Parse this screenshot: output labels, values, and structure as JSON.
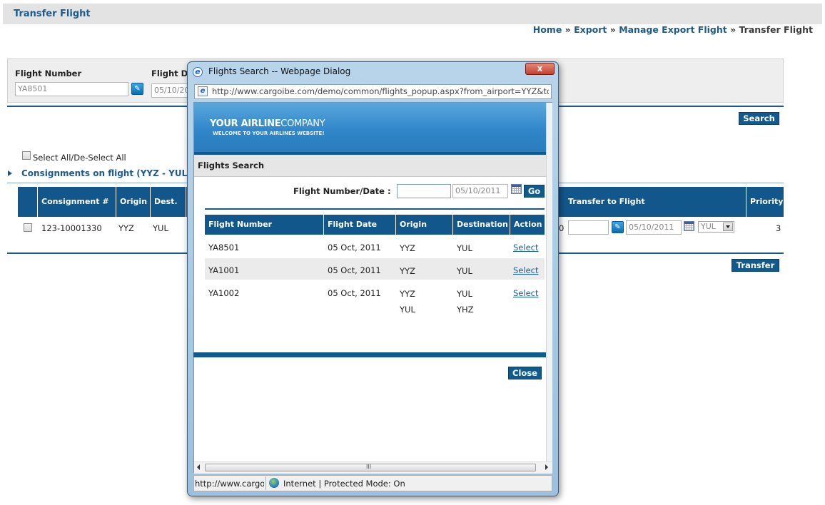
{
  "page": {
    "title": "Transfer Flight",
    "breadcrumb": {
      "home": "Home",
      "export": "Export",
      "manage": "Manage Export Flight",
      "current": "Transfer Flight",
      "sep": "»"
    }
  },
  "search": {
    "flight_number_label": "Flight Number",
    "flight_number_value": "YA8501",
    "flight_date_label": "Flight D",
    "flight_date_value": "05/10/20",
    "search_button": "Search"
  },
  "consignments": {
    "select_all_label": "Select All/De-Select All",
    "section_title": "Consignments on flight (YYZ - YUL)",
    "columns": [
      "Consignment #",
      "Origin",
      "Dest.",
      "Transfer to Flight",
      "Priority"
    ],
    "rows": [
      {
        "consignment": "123-10001330",
        "origin": "YYZ",
        "dest": "YUL",
        "hidden_partial": "0",
        "transfer_flight": "",
        "transfer_date": "05/10/2011",
        "transfer_dest": "YUL",
        "priority": "3"
      }
    ],
    "transfer_button": "Transfer"
  },
  "dialog": {
    "window_title": "Flights Search -- Webpage Dialog",
    "url": "http://www.cargoibe.com/demo/common/flights_popup.aspx?from_airport=YYZ&to_air",
    "banner": {
      "name_bold": "YOUR AIRLINE",
      "name_thin": "COMPANY",
      "tagline": "WELCOME TO YOUR AIRLINES WEBSITE!"
    },
    "header": "Flights Search",
    "search_label": "Flight Number/Date :",
    "flight_input": "",
    "date_input": "05/10/2011",
    "go_button": "Go",
    "columns": [
      "Flight Number",
      "Flight Date",
      "Origin",
      "Destination",
      "Action"
    ],
    "rows": [
      {
        "flight": "YA8501",
        "date": "05 Oct, 2011",
        "origin": "YYZ",
        "destination": "YUL",
        "origin2": "",
        "destination2": "",
        "action": "Select"
      },
      {
        "flight": "YA1001",
        "date": "05 Oct, 2011",
        "origin": "YYZ",
        "destination": "YUL",
        "origin2": "",
        "destination2": "",
        "action": "Select"
      },
      {
        "flight": "YA1002",
        "date": "05 Oct, 2011",
        "origin": "YYZ",
        "destination": "YUL",
        "origin2": "YUL",
        "destination2": "YHZ",
        "action": "Select"
      }
    ],
    "close_button": "Close",
    "status_url": "http://www.cargoi",
    "status_zone": "Internet | Protected Mode: On",
    "close_glyph": "x",
    "scroll_grip": "III"
  }
}
